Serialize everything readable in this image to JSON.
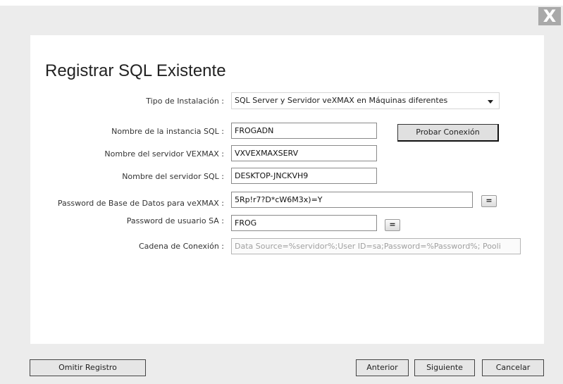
{
  "dialog": {
    "close_label": "X",
    "title": "Registrar SQL Existente"
  },
  "form": {
    "tipo_label": "Tipo de Instalación :",
    "tipo_value": "SQL Server y Servidor veXMAX en Máquinas diferentes",
    "instancia_label": "Nombre de la instancia SQL :",
    "instancia_value": "FROGADN",
    "probar_label": "Probar Conexión",
    "servidor_vexmax_label": "Nombre del servidor VEXMAX :",
    "servidor_vexmax_value": "VXVEXMAXSERV",
    "servidor_sql_label": "Nombre del servidor SQL :",
    "servidor_sql_value": "DESKTOP-JNCKVH9",
    "password_bd_label": "Password de Base de Datos para veXMAX :",
    "password_bd_value": "5Rp!r7?D*cW6M3x)=Y",
    "password_sa_label": "Password de usuario SA :",
    "password_sa_value": "FROG",
    "reveal_label": "=",
    "cadena_label": "Cadena de Conexión :",
    "cadena_value": "Data Source=%servidor%;User ID=sa;Password=%Password%; Pooli"
  },
  "footer": {
    "omitir_label": "Omitir Registro",
    "anterior_label": "Anterior",
    "siguiente_label": "Siguiente",
    "cancelar_label": "Cancelar"
  }
}
